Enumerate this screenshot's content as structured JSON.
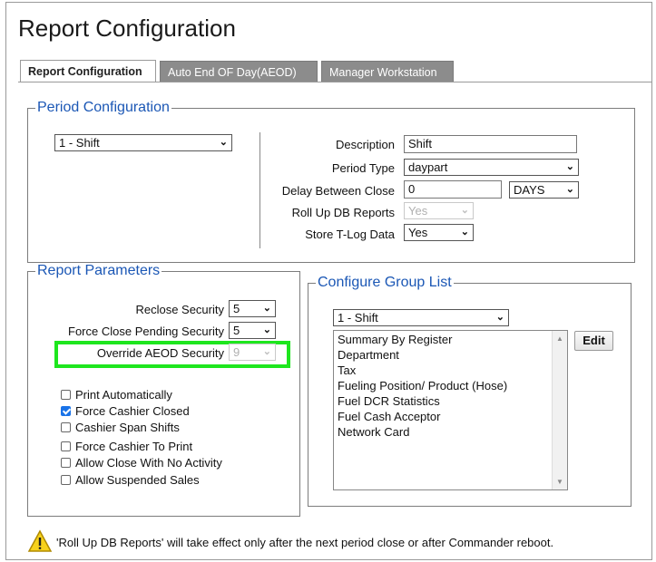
{
  "window": {
    "title": "Report Configuration"
  },
  "tabs": [
    {
      "label": "Report Configuration",
      "active": true
    },
    {
      "label": "Auto End OF Day(AEOD)",
      "active": false
    },
    {
      "label": "Manager Workstation",
      "active": false
    }
  ],
  "period_config": {
    "legend": "Period Configuration",
    "period_select": "1 - Shift",
    "description_label": "Description",
    "description_value": "Shift",
    "period_type_label": "Period Type",
    "period_type_value": "daypart",
    "delay_label": "Delay Between Close",
    "delay_value": "0",
    "delay_unit": "DAYS",
    "rollup_label": "Roll Up DB Reports",
    "rollup_value": "Yes",
    "tlog_label": "Store T-Log Data",
    "tlog_value": "Yes"
  },
  "report_params": {
    "legend": "Report Parameters",
    "reclose_label": "Reclose Security",
    "reclose_value": "5",
    "force_close_label": "Force Close Pending Security",
    "force_close_value": "5",
    "override_label": "Override AEOD Security",
    "override_value": "9",
    "checkboxes": [
      {
        "label": "Print Automatically",
        "checked": false
      },
      {
        "label": "Force Cashier Closed",
        "checked": true
      },
      {
        "label": "Cashier Span Shifts",
        "checked": false
      },
      {
        "label": "Force Cashier To Print",
        "checked": false
      },
      {
        "label": "Allow Close With No Activity",
        "checked": false
      },
      {
        "label": "Allow Suspended Sales",
        "checked": false
      }
    ]
  },
  "group_list": {
    "legend": "Configure Group List",
    "group_select": "1 - Shift",
    "items": [
      "Summary By Register",
      "Department",
      "Tax",
      "Fueling Position/ Product (Hose)",
      "Fuel DCR Statistics",
      "Fuel Cash Acceptor",
      "Network Card"
    ],
    "edit_label": "Edit"
  },
  "footer": {
    "warning_text": "'Roll Up DB Reports' will take effect only after the next period close or after Commander reboot."
  },
  "colors": {
    "legend_blue": "#1b57b5",
    "highlight_green": "#1ee61e",
    "checkbox_blue": "#1a73e8",
    "tab_inactive": "#8c8c8c"
  }
}
